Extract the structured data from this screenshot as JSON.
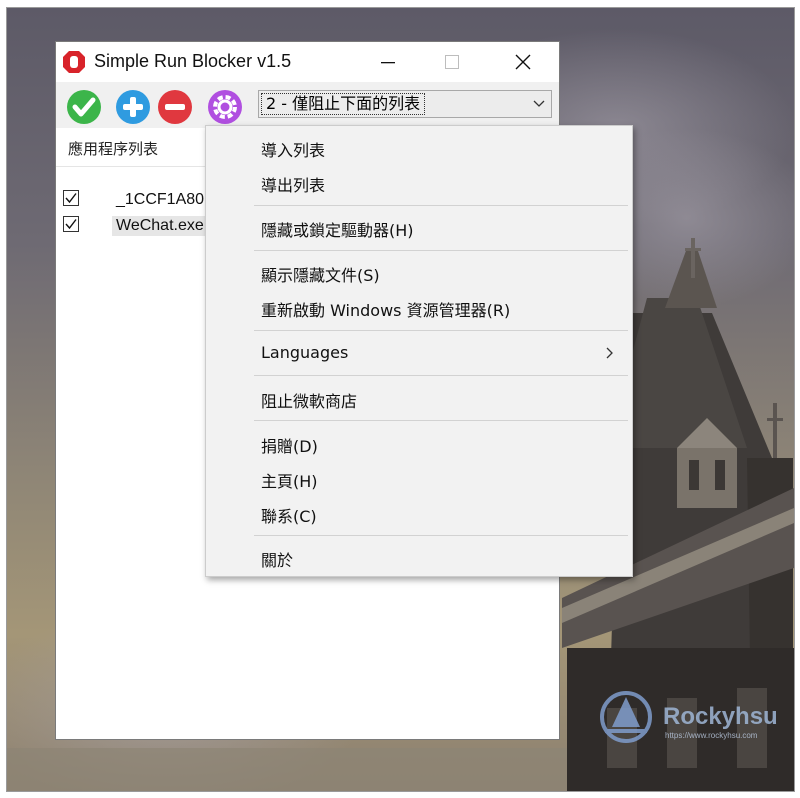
{
  "window": {
    "title": "Simple Run Blocker v1.5",
    "controls": {
      "minimize": "minimize",
      "maximize": "maximize",
      "close": "close"
    }
  },
  "toolbar": {
    "buttons": [
      {
        "icon": "check-icon",
        "color": "#3cb54a"
      },
      {
        "icon": "plus-icon",
        "color": "#2f9be0"
      },
      {
        "icon": "minus-icon",
        "color": "#e0383f"
      },
      {
        "icon": "gear-icon",
        "color": "#b04fe0"
      }
    ],
    "mode_select": {
      "value": "2 - 僅阻止下面的列表"
    }
  },
  "list": {
    "header": "應用程序列表",
    "items": [
      {
        "label": "_1CCF1A80",
        "checked": true
      },
      {
        "label": "WeChat.exe",
        "checked": true
      }
    ]
  },
  "menu": {
    "items": [
      {
        "label": "導入列表"
      },
      {
        "label": "導出列表"
      },
      {
        "label": "隱藏或鎖定驅動器(H)"
      },
      {
        "label": "顯示隱藏文件(S)"
      },
      {
        "label": "重新啟動 Windows 資源管理器(R)"
      },
      {
        "label": "Languages",
        "submenu": true
      },
      {
        "label": "阻止微軟商店"
      },
      {
        "label": "捐贈(D)"
      },
      {
        "label": "主頁(H)"
      },
      {
        "label": "聯系(C)"
      },
      {
        "label": "關於"
      }
    ]
  },
  "watermark": {
    "text": "Rockyhsu",
    "url": "https://www.rockyhsu.com"
  }
}
